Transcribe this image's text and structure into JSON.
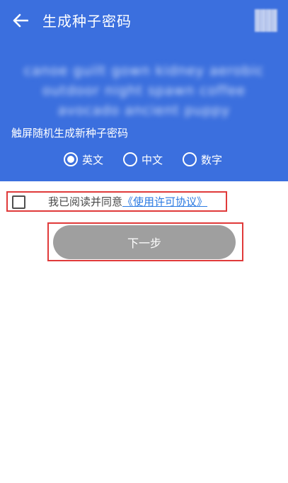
{
  "header": {
    "title": "生成种子密码",
    "background_color": "#3b6fde",
    "back_icon": "back-arrow-icon",
    "qr_icon": "qr-code-thumbnail"
  },
  "mnemonic": {
    "words_blurred": "canoe guilt gown kidney aerobic outdoor night spawn coffee avocado ancient puppy"
  },
  "hint": "触屏随机生成新种子密码",
  "language_options": [
    {
      "label": "英文",
      "selected": true
    },
    {
      "label": "中文",
      "selected": false
    },
    {
      "label": "数字",
      "selected": false
    }
  ],
  "agreement": {
    "checked": false,
    "text": "我已阅读并同意",
    "link": "《使用许可协议》"
  },
  "next_button": {
    "label": "下一步",
    "enabled": false
  },
  "highlight_color": "#e03a3a"
}
